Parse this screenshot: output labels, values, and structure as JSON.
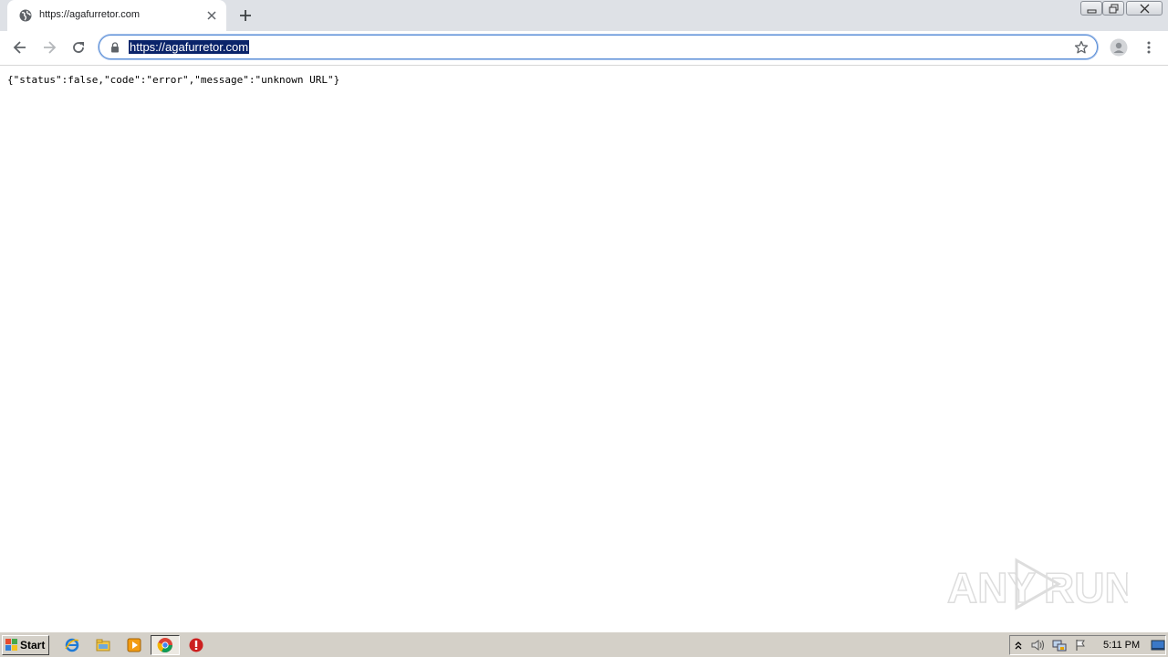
{
  "tab": {
    "title": "https://agafurretor.com",
    "favicon": "globe-icon"
  },
  "omnibox": {
    "url": "https://agafurretor.com",
    "selected": true
  },
  "page": {
    "body_text": "{\"status\":false,\"code\":\"error\",\"message\":\"unknown URL\"}"
  },
  "watermark": {
    "text_left": "ANY",
    "text_right": "RUN"
  },
  "taskbar": {
    "start_label": "Start",
    "clock": "5:11 PM",
    "apps": [
      "internet-explorer-icon",
      "file-explorer-icon",
      "media-player-icon",
      "chrome-icon",
      "stop-icon"
    ]
  },
  "colors": {
    "tabstrip": "#dee1e6",
    "selection": "#0a246a",
    "omnibox_border": "#5b8fd8",
    "taskbar": "#d4d0c8"
  }
}
